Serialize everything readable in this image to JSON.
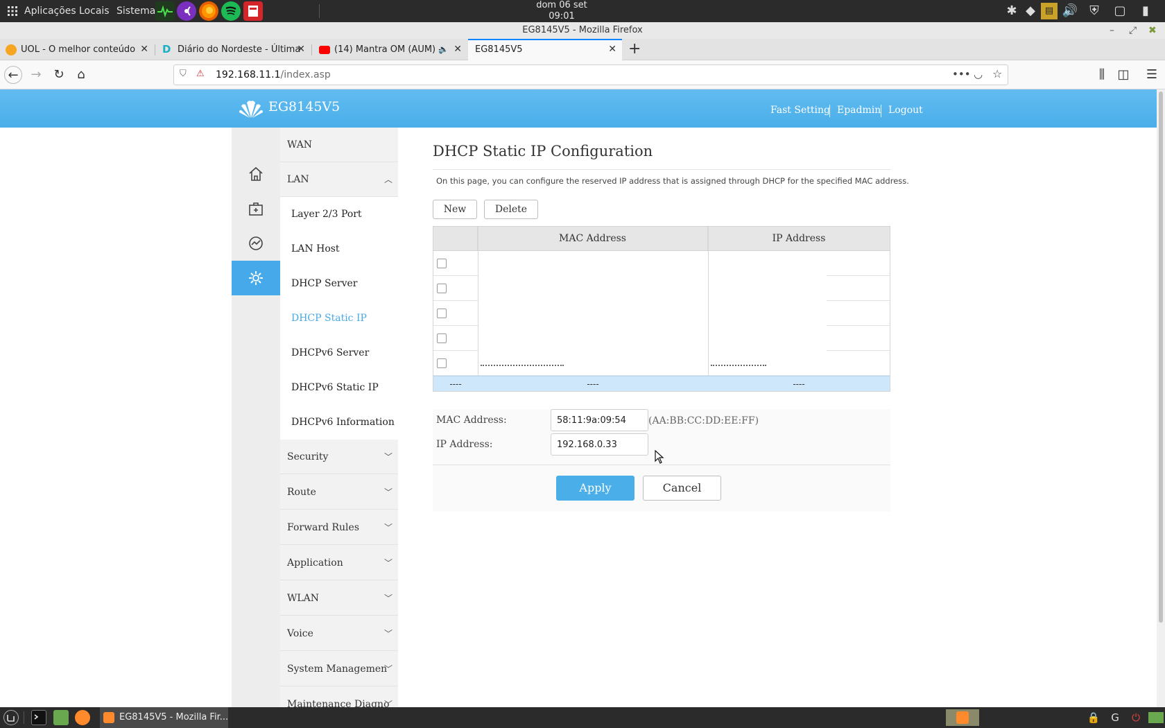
{
  "os": {
    "menu": [
      "Aplicações",
      "Locais",
      "Sistema"
    ],
    "clock_date": "dom 06 set",
    "clock_time": "09:01"
  },
  "window": {
    "title": "EG8145V5 - Mozilla Firefox"
  },
  "tabs": [
    {
      "label": "UOL - O melhor conteúdo",
      "favicon_icon": "uol-icon"
    },
    {
      "label": "Diário do Nordeste - Última",
      "favicon_icon": "letter-d-icon"
    },
    {
      "label": "(14) Mantra OM (AUM) -",
      "favicon_icon": "youtube-icon"
    },
    {
      "label": "EG8145V5",
      "favicon_icon": "none"
    }
  ],
  "urlbar": {
    "host": "192.168.11.1",
    "path": "/index.asp"
  },
  "router": {
    "brand": "EG8145V5",
    "header_links": [
      "Fast Setting",
      "Epadmin",
      "Logout"
    ],
    "rail_icons": [
      "home-icon",
      "toolbox-icon",
      "gauge-icon",
      "gear-icon"
    ],
    "menu": {
      "wan": "WAN",
      "lan": "LAN",
      "lan_items": [
        "Layer 2/3 Port",
        "LAN Host",
        "DHCP Server",
        "DHCP Static IP",
        "DHCPv6 Server",
        "DHCPv6 Static IP",
        "DHCPv6 Information"
      ],
      "selected": "DHCP Static IP",
      "sections": [
        "Security",
        "Route",
        "Forward Rules",
        "Application",
        "WLAN",
        "Voice",
        "System Managemen",
        "Maintenance Diagno"
      ]
    },
    "page": {
      "title": "DHCP Static IP Configuration",
      "description": "On this page, you can configure the reserved IP address that is assigned through DHCP for the specified MAC address.",
      "new_label": "New",
      "delete_label": "Delete",
      "table": {
        "headers": [
          "MAC Address",
          "IP Address"
        ],
        "footer": [
          "----",
          "----",
          "----"
        ]
      },
      "form": {
        "mac_label": "MAC Address:",
        "mac_value": "58:11:9a:09:54",
        "mac_hint": "(AA:BB:CC:DD:EE:FF)",
        "ip_label": "IP Address:",
        "ip_value": "192.168.0.33",
        "apply_label": "Apply",
        "cancel_label": "Cancel"
      }
    }
  },
  "taskbar": {
    "task_label": "EG8145V5 - Mozilla Fir..."
  },
  "colors": {
    "accent": "#4aaee9",
    "selected_menu": "#47a9e6",
    "tab_highlight": "#0a84ff"
  }
}
